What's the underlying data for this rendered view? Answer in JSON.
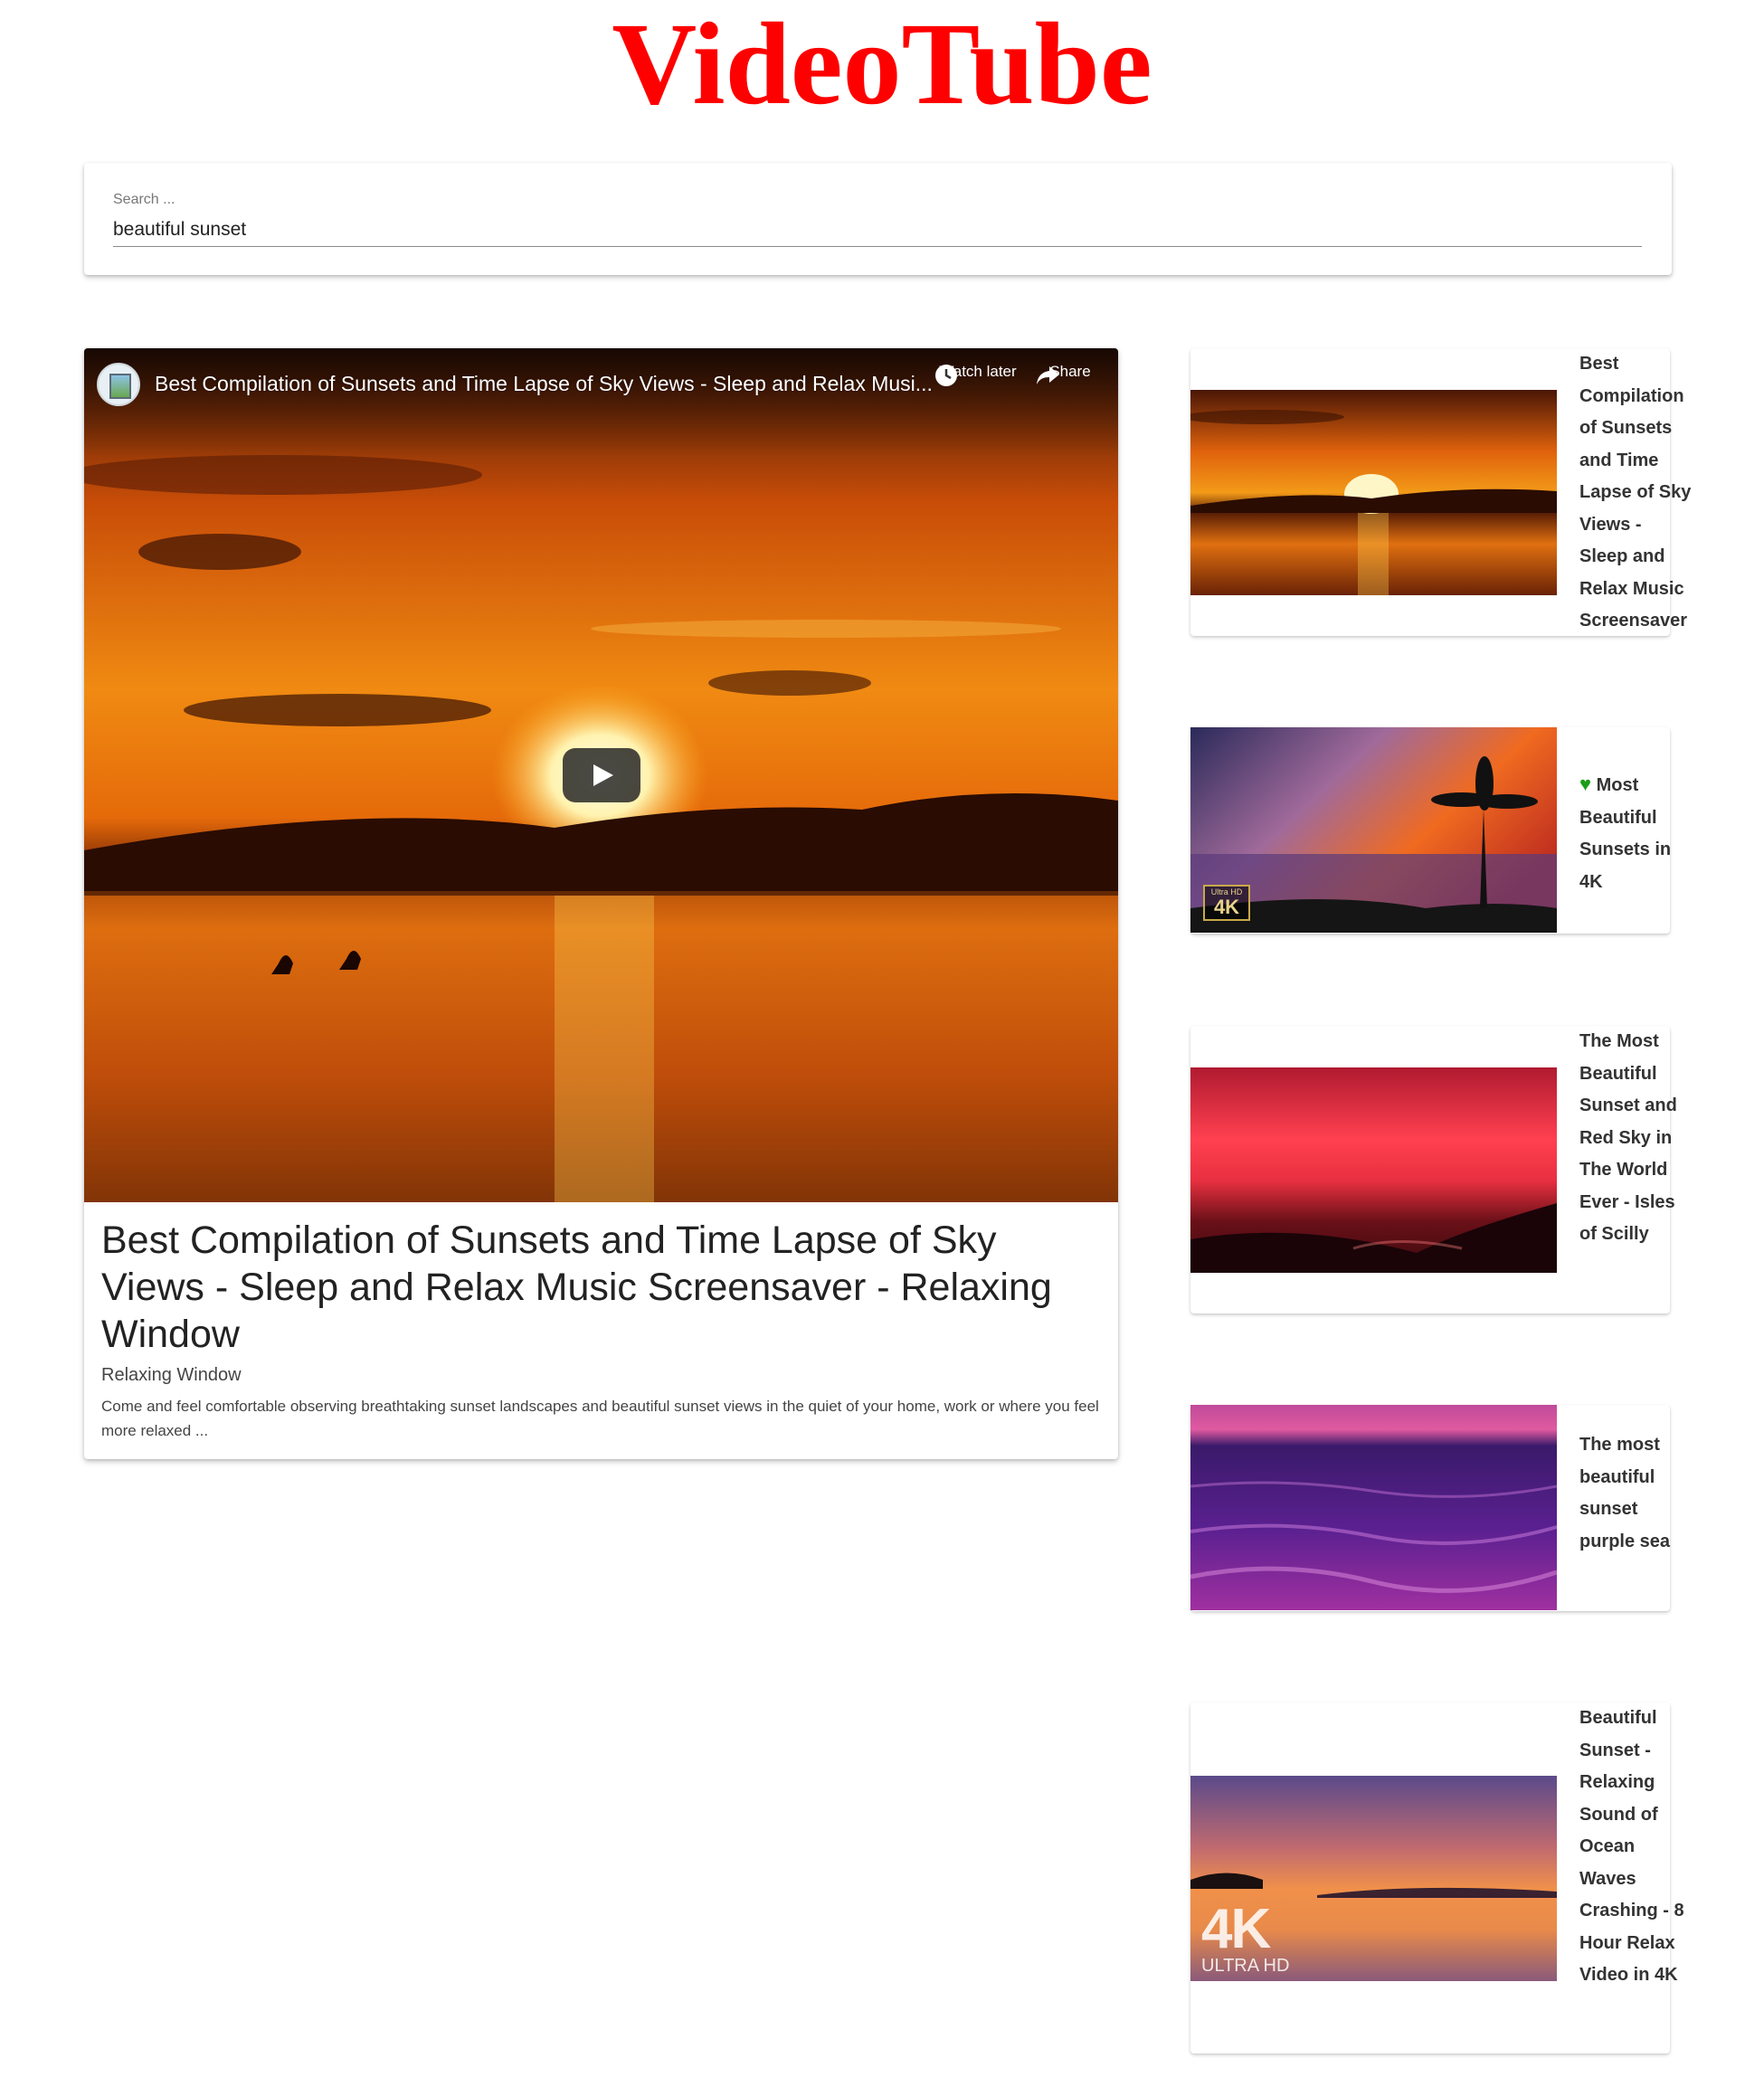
{
  "app": {
    "title": "VideoTube",
    "title_color": "#ff0000"
  },
  "search": {
    "label": "Search ...",
    "value": "beautiful sunset"
  },
  "main_video": {
    "player_title": "Best Compilation of Sunsets and Time Lapse of Sky Views - Sleep and Relax Musi...",
    "watch_later_label": "Watch later",
    "share_label": "Share",
    "title": "Best Compilation of Sunsets and Time Lapse of Sky Views - Sleep and Relax Music Screensaver - Relaxing Window",
    "channel": "Relaxing Window",
    "description": "Come and feel comfortable observing breathtaking sunset landscapes and beautiful sunset views in the quiet of your home, work or where you feel more relaxed ..."
  },
  "video_list": [
    {
      "title": "Best Compilation of Sunsets and Time Lapse of Sky Views - Sleep and Relax Music Screensaver"
    },
    {
      "title": "Most Beautiful Sunsets in 4K",
      "icon": "green-heart-icon"
    },
    {
      "title": "The Most Beautiful Sunset and Red Sky in The World Ever - Isles of Scilly"
    },
    {
      "title": "The most beautiful sunset purple sea"
    },
    {
      "title": "Beautiful Sunset - Relaxing Sound of Ocean Waves Crashing - 8 Hour Relax Video in 4K"
    }
  ],
  "badges": {
    "ultra_hd_small": "Ultra HD",
    "four_k": "4K",
    "ultra_hd_caps": "ULTRA HD"
  }
}
